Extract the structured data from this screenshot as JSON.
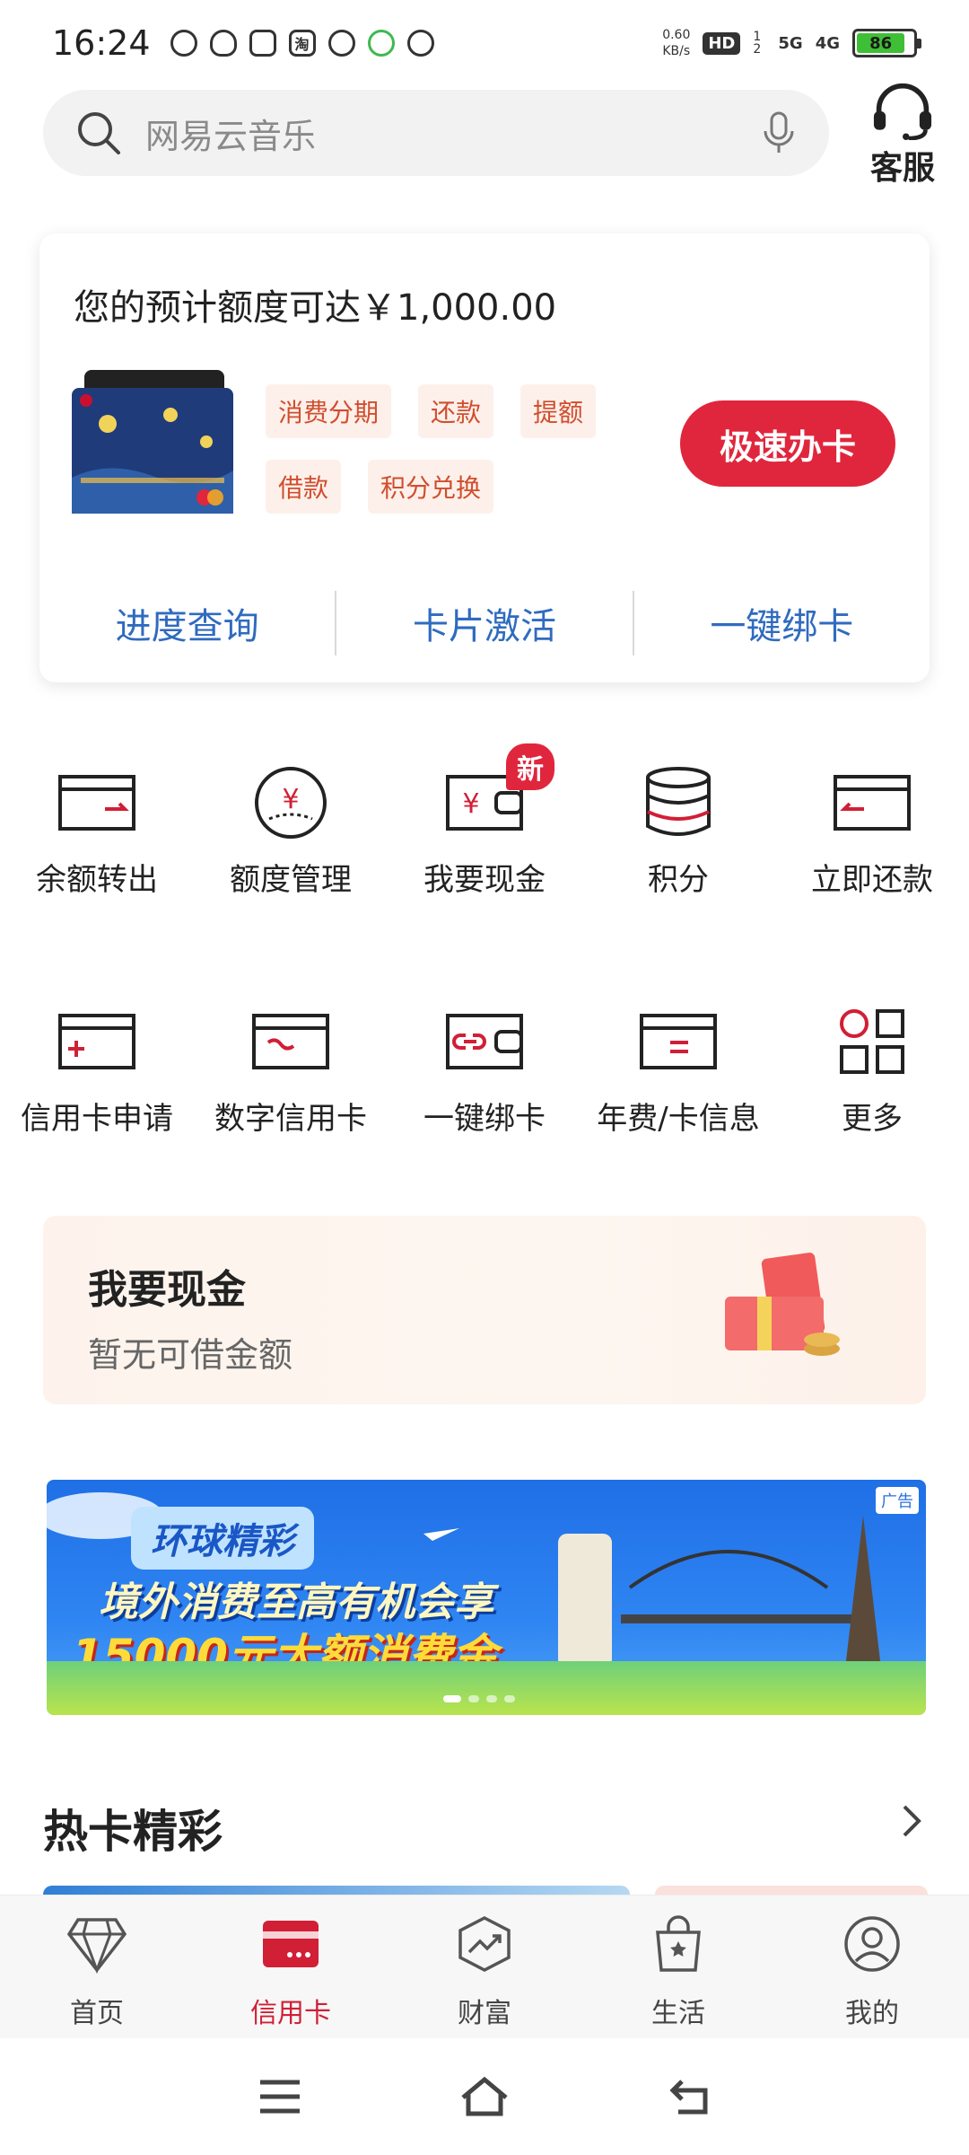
{
  "status_bar": {
    "time": "16:24",
    "app_icons": [
      "wechat-icon",
      "qq-icon",
      "hand-icon",
      "taobao-icon",
      "mask-icon",
      "green-icon",
      "weibo-icon"
    ],
    "taobao_glyph": "淘",
    "net_speed_value": "0.60",
    "net_speed_unit": "KB/s",
    "hd_label": "HD",
    "sim_label": "1 2",
    "sig1": "5G",
    "sig2": "4G",
    "battery": "86"
  },
  "search": {
    "placeholder": "网易云音乐"
  },
  "service": {
    "label": "客服"
  },
  "card_panel": {
    "title": "您的预计额度可达￥1,000.00",
    "tags": [
      "消费分期",
      "还款",
      "提额",
      "借款",
      "积分兑换"
    ],
    "apply_button": "极速办卡",
    "links": [
      "进度查询",
      "卡片激活",
      "一键绑卡"
    ]
  },
  "grid_row1": [
    {
      "label": "余额转出",
      "icon": "transfer-out-icon"
    },
    {
      "label": "额度管理",
      "icon": "limit-manage-icon"
    },
    {
      "label": "我要现金",
      "icon": "cash-wallet-icon",
      "badge": "新"
    },
    {
      "label": "积分",
      "icon": "points-icon"
    },
    {
      "label": "立即还款",
      "icon": "repay-icon"
    }
  ],
  "grid_row2": [
    {
      "label": "信用卡申请",
      "icon": "card-apply-icon"
    },
    {
      "label": "数字信用卡",
      "icon": "digital-card-icon"
    },
    {
      "label": "一键绑卡",
      "icon": "bind-card-icon"
    },
    {
      "label": "年费/卡信息",
      "icon": "annual-fee-icon"
    },
    {
      "label": "更多",
      "icon": "more-grid-icon"
    }
  ],
  "cash_block": {
    "title": "我要现金",
    "subtitle": "暂无可借金额"
  },
  "banner": {
    "ad_label": "广告",
    "chip": "环球精彩",
    "line1": "境外消费至高有机会享",
    "line2": "15000元大额消费金"
  },
  "hot_cards": {
    "title": "热卡精彩"
  },
  "tabs": [
    {
      "label": "首页",
      "icon": "diamond-icon",
      "active": false
    },
    {
      "label": "信用卡",
      "icon": "credit-card-icon",
      "active": true
    },
    {
      "label": "财富",
      "icon": "wealth-icon",
      "active": false
    },
    {
      "label": "生活",
      "icon": "life-bag-icon",
      "active": false
    },
    {
      "label": "我的",
      "icon": "profile-icon",
      "active": false
    }
  ],
  "colors": {
    "accent": "#e0263d",
    "link": "#2f6bbf",
    "tag_text": "#d04e2e",
    "tag_bg": "#fdf0ea"
  }
}
